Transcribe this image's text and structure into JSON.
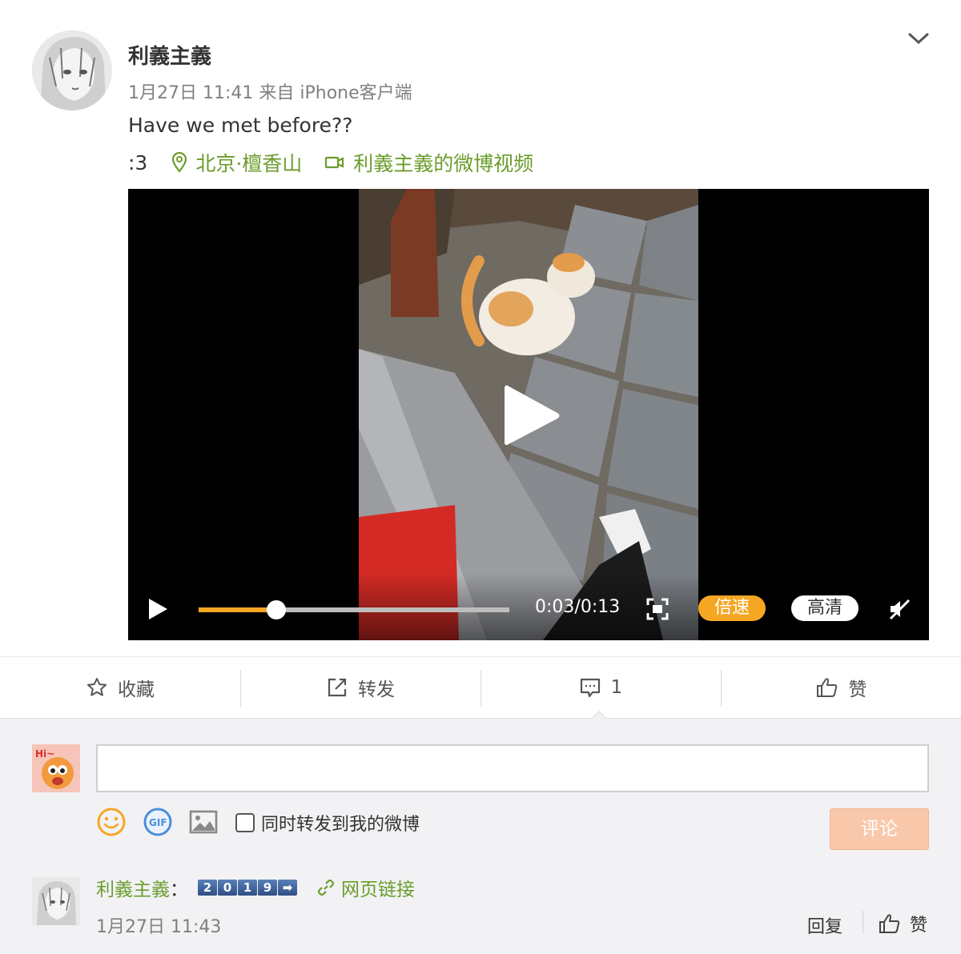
{
  "post": {
    "author": "利義主義",
    "meta": "1月27日 11:41 来自 iPhone客户端",
    "text": "Have we met before??",
    "emoticon": ":3",
    "location": "北京·檀香山",
    "video_link": "利義主義的微博视频"
  },
  "video": {
    "time": "0:03/0:13",
    "progress": 0.25,
    "speed_label": "倍速",
    "quality_label": "高清"
  },
  "actions": {
    "favorite": "收藏",
    "repost": "转发",
    "comments": "1",
    "like": "赞"
  },
  "composer": {
    "placeholder": "",
    "forward_label": "同时转发到我的微博",
    "submit_label": "评论"
  },
  "comment": {
    "author": "利義主義",
    "colon": "：",
    "badge": [
      "2",
      "0",
      "1",
      "9",
      "➡"
    ],
    "link": "网页链接",
    "time": "1月27日 11:43",
    "reply": "回复",
    "like": "赞"
  },
  "colors": {
    "link_green": "#6b9d2b",
    "accent_orange": "#f5a623",
    "submit_disabled": "#f9c8ab"
  }
}
